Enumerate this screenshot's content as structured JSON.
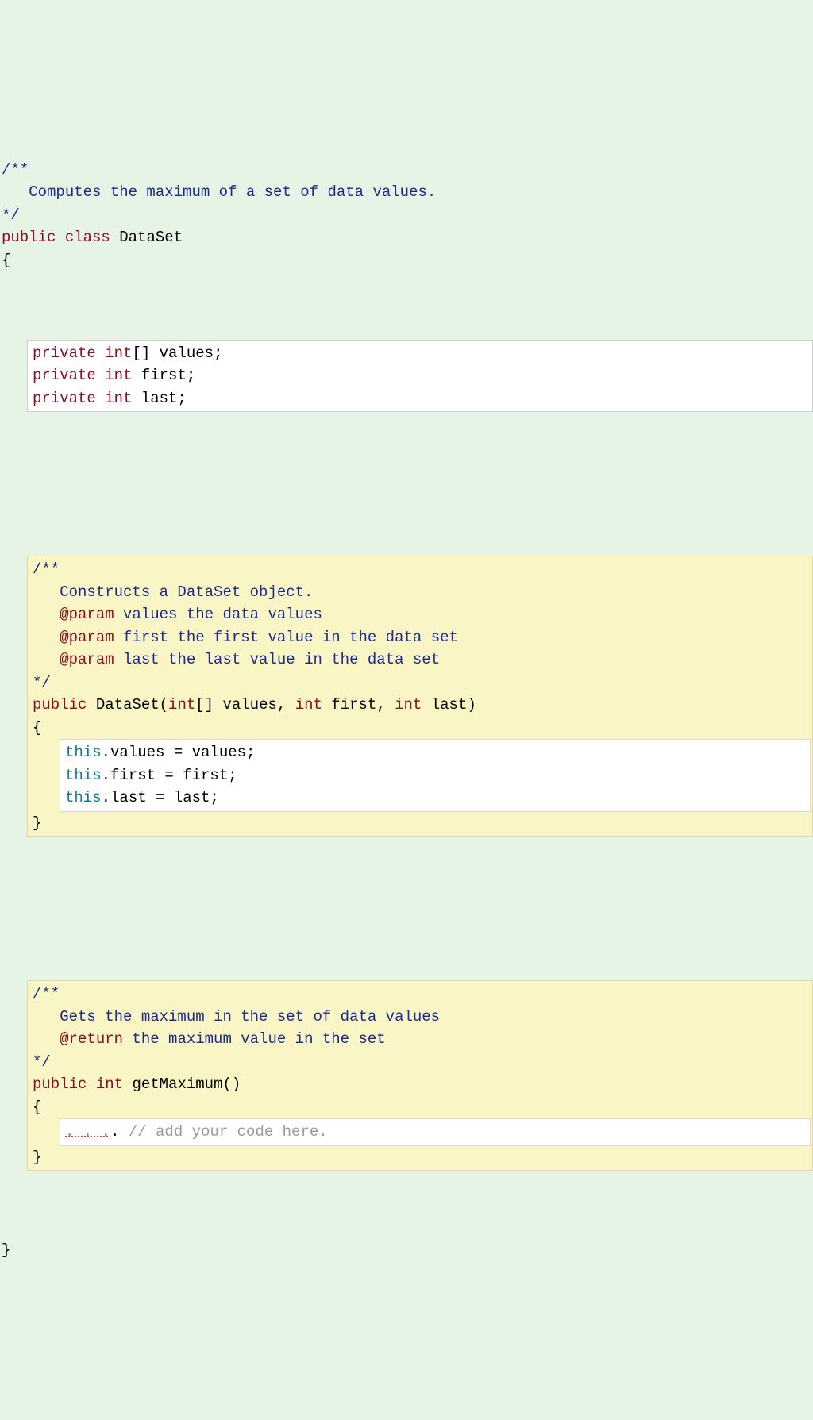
{
  "topComment": {
    "open": "/**",
    "line1": "   Computes the maximum of a set of data values.",
    "close": "*/"
  },
  "classDecl": {
    "kwPublic": "public",
    "kwClass": "class",
    "name": "DataSet",
    "braceOpen": "{",
    "braceClose": "}"
  },
  "fields": {
    "l1_kwPrivate": "private",
    "l1_kwInt": "int",
    "l1_rest": "[] values;",
    "l2_kwPrivate": "private",
    "l2_kwInt": "int",
    "l2_rest": " first;",
    "l3_kwPrivate": "private",
    "l3_kwInt": "int",
    "l3_rest": " last;"
  },
  "ctorDoc": {
    "open": "/**",
    "l1": "   Constructs a DataSet object.",
    "l2a": "   @param",
    "l2b": " values the data values",
    "l3a": "   @param",
    "l3b": " first the first value in the data set",
    "l4a": "   @param",
    "l4b": " last the last value in the data set",
    "close": "*/"
  },
  "ctorSig": {
    "kwPublic": "public",
    "name": " DataSet(",
    "kwInt1": "int",
    "p1": "[] values, ",
    "kwInt2": "int",
    "p2": " first, ",
    "kwInt3": "int",
    "p3": " last)",
    "braceOpen": "{",
    "braceClose": "}"
  },
  "ctorBody": {
    "l1a": "this",
    "l1b": ".values = values;",
    "l2a": "this",
    "l2b": ".first = first;",
    "l3a": "this",
    "l3b": ".last = last;"
  },
  "getMaxDoc": {
    "open": "/**",
    "l1": "   Gets the maximum in the set of data values",
    "l2a": "   @return",
    "l2b": " the maximum value in the set",
    "close": "*/"
  },
  "getMaxSig": {
    "kwPublic": "public",
    "kwInt": "int",
    "name": " getMaximum()",
    "braceOpen": "{",
    "braceClose": "}"
  },
  "placeholder": {
    "dots": ". . .",
    "sep": ". ",
    "comment": "// add your code here."
  }
}
